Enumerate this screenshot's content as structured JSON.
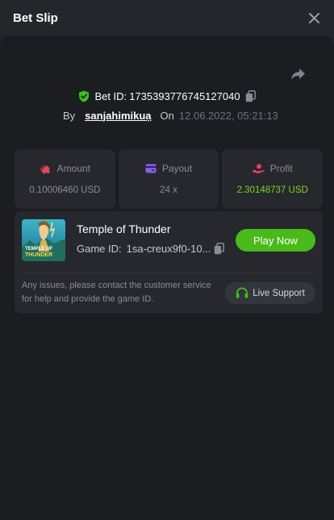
{
  "header": {
    "title": "Bet Slip"
  },
  "bet": {
    "id_label": "Bet ID:",
    "id": "1735393776745127040",
    "by_label": "By",
    "username": "sanjahimikuạ",
    "on_label": "On",
    "date": "12.06.2022, 05:21:13"
  },
  "stats": {
    "amount": {
      "label": "Amount",
      "value": "0.10006460 USD"
    },
    "payout": {
      "label": "Payout",
      "value": "24 x"
    },
    "profit": {
      "label": "Profit",
      "value": "2.30148737 USD"
    }
  },
  "game": {
    "name": "Temple of Thunder",
    "id_label": "Game ID:",
    "id": "1sa-creux9f0-10...",
    "play_label": "Play Now",
    "thumb_title_1": "TEMPLE OF",
    "thumb_title_2": "THUNDER",
    "notice": "Any issues, please contact the customer service for help and provide the game ID.",
    "support_label": "Live Support"
  },
  "colors": {
    "accent_green": "#4aba1b",
    "profit_green": "#7ed321",
    "amount_icon": "#e8445a",
    "payout_icon": "#8b5cf6",
    "profit_icon": "#e8445a"
  }
}
